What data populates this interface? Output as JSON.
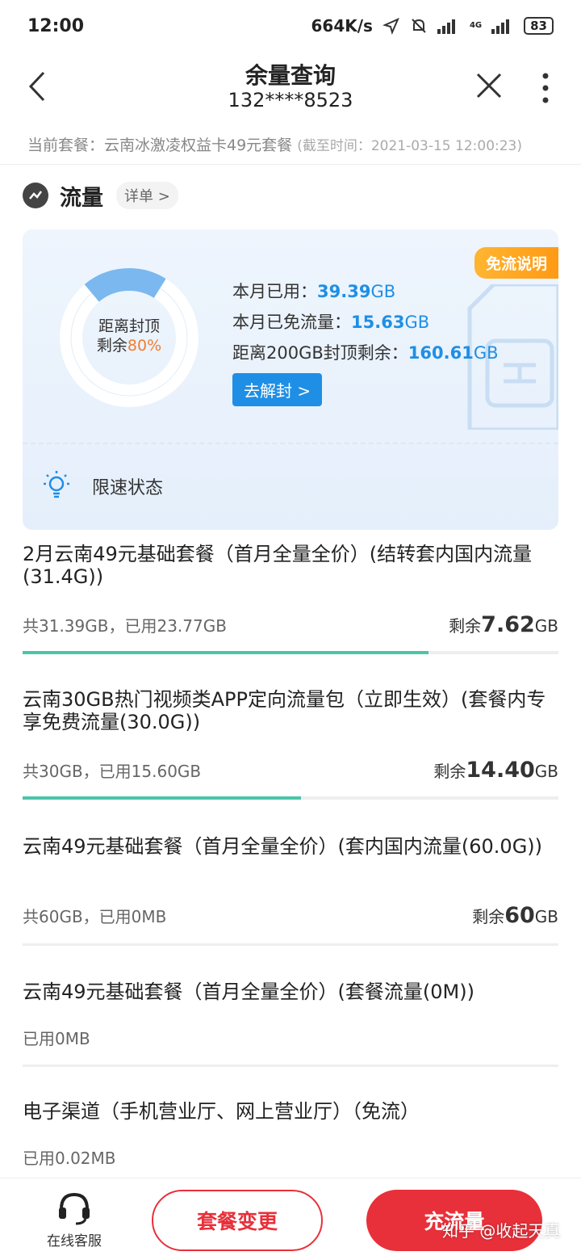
{
  "status_bar": {
    "time": "12:00",
    "net_speed": "664K/s",
    "net_type": "4G",
    "battery": "83"
  },
  "header": {
    "title": "余量查询",
    "phone": "132****8523"
  },
  "plan": {
    "label": "当前套餐：云南冰激凌权益卡49元套餐",
    "cutoff": "(截至时间：2021-03-15 12:00:23)"
  },
  "section": {
    "title": "流量",
    "detail": "详单 >"
  },
  "summary": {
    "badge": "免流说明",
    "donut_line1": "距离封顶",
    "donut_line2": "剩余",
    "donut_pct": "80%",
    "donut_remaining_fraction": 0.8,
    "used_label": "本月已用：",
    "used_value": "39.39",
    "used_unit": "GB",
    "free_label": "本月已免流量：",
    "free_value": "15.63",
    "free_unit": "GB",
    "cap_label": "距离200GB封顶剩余：",
    "cap_value": "160.61",
    "cap_unit": "GB",
    "unblock_btn": "去解封 >",
    "limit_label": "限速状态"
  },
  "items": [
    {
      "name": "2月云南49元基础套餐（首月全量全价）(结转套内国内流量(31.4G))",
      "sub": "共31.39GB，已用23.77GB",
      "rem_label": "剩余",
      "rem_value": "7.62",
      "rem_unit": "GB",
      "used_fraction": 0.757
    },
    {
      "name": "云南30GB热门视频类APP定向流量包（立即生效）(套餐内专享免费流量(30.0G))",
      "sub": "共30GB，已用15.60GB",
      "rem_label": "剩余",
      "rem_value": "14.40",
      "rem_unit": "GB",
      "used_fraction": 0.52
    },
    {
      "name": "云南49元基础套餐（首月全量全价）(套内国内流量(60.0G))",
      "sub": "共60GB，已用0MB",
      "rem_label": "剩余",
      "rem_value": "60",
      "rem_unit": "GB",
      "used_fraction": 0
    },
    {
      "name": "云南49元基础套餐（首月全量全价）(套餐流量(0M))",
      "sub": "已用0MB"
    },
    {
      "name": "电子渠道（手机营业厅、网上营业厅）（免流）",
      "sub": "已用0.02MB"
    }
  ],
  "bottom": {
    "service": "在线客服",
    "change_btn": "套餐变更",
    "recharge_btn": "充流量"
  },
  "watermark": "知乎 @收起天真",
  "colors": {
    "accent": "#1f8fe5",
    "primary_red": "#e8303a",
    "progress": "#4ac5a8",
    "orange": "#ff9a14"
  }
}
